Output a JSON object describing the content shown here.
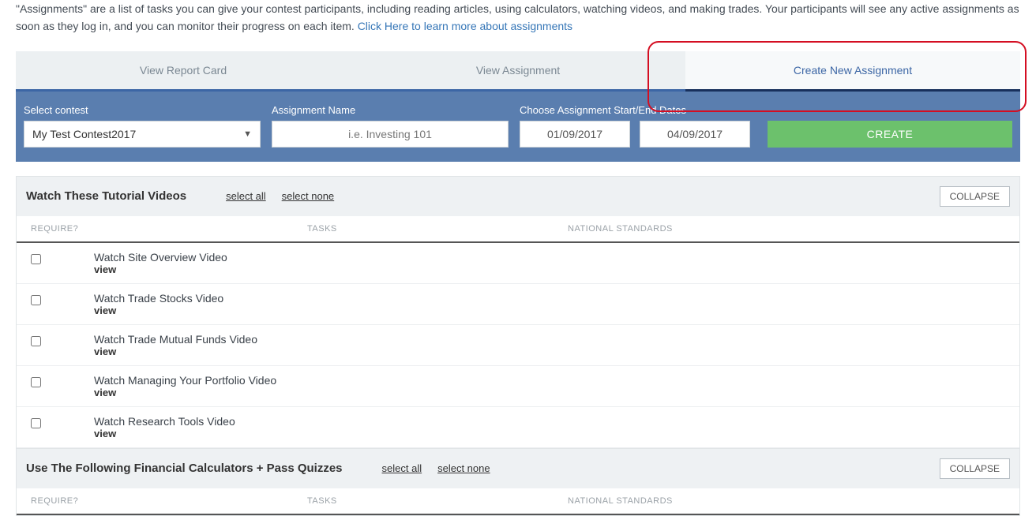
{
  "intro": {
    "text_a": "\"Assignments\" are a list of tasks you can give your contest participants, including reading articles, using calculators, watching videos, and making trades. Your participants will see any active assignments as soon as they log in, and you can monitor their progress on each item. ",
    "link_text": "Click Here to learn more about assignments"
  },
  "tabs": {
    "report": "View Report Card",
    "view": "View Assignment",
    "create": "Create New Assignment"
  },
  "form": {
    "contest_label": "Select contest",
    "contest_value": "My Test Contest2017",
    "name_label": "Assignment Name",
    "name_placeholder": "i.e. Investing 101",
    "dates_label": "Choose Assignment Start/End Dates",
    "date_start": "01/09/2017",
    "date_end": "04/09/2017",
    "create_btn": "CREATE"
  },
  "columns": {
    "require": "REQUIRE?",
    "tasks": "TASKS",
    "standards": "NATIONAL STANDARDS"
  },
  "links": {
    "select_all": "select all",
    "select_none": "select none",
    "collapse": "COLLAPSE",
    "view": "view"
  },
  "section1": {
    "title": "Watch These Tutorial Videos",
    "tasks": [
      "Watch Site Overview Video",
      "Watch Trade Stocks Video",
      "Watch Trade Mutual Funds Video",
      "Watch Managing Your Portfolio Video",
      "Watch Research Tools Video"
    ]
  },
  "section2": {
    "title": "Use The Following Financial Calculators + Pass Quizzes"
  }
}
